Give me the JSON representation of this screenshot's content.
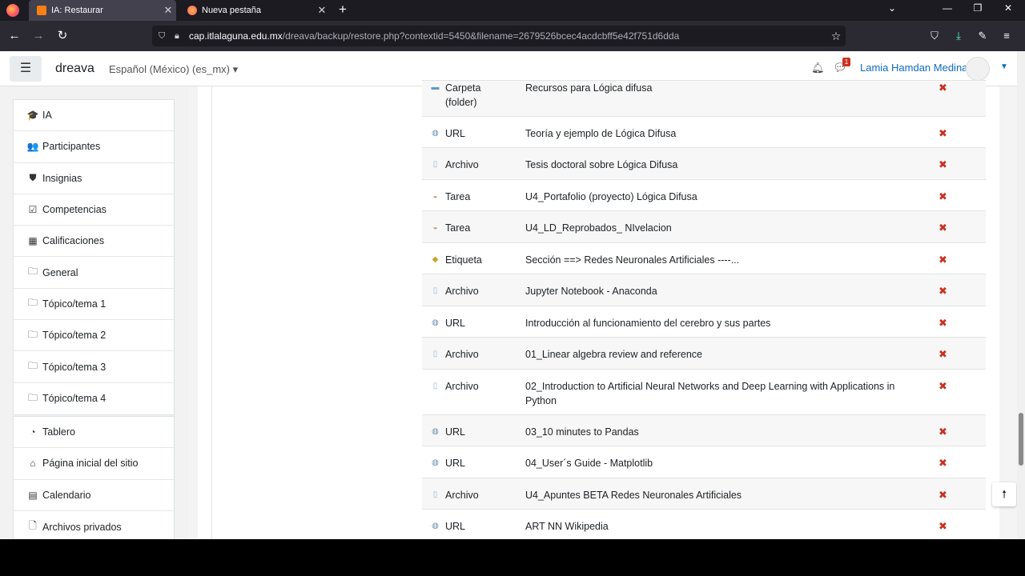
{
  "browser": {
    "tabs": [
      {
        "label": "IA: Restaurar",
        "active": true
      },
      {
        "label": "Nueva pestaña",
        "active": false
      }
    ],
    "url_domain": "cap.itlalaguna.edu.mx",
    "url_path": "/dreava/backup/restore.php?contextid=5450&filename=2679526bcec4acdcbff5e42f751d6dda",
    "new_tab_glyph": "+",
    "close_glyph": "✕"
  },
  "header": {
    "site_name": "dreava",
    "language": "Español (México) (es_mx)",
    "message_count": "1",
    "user_name": "Lamia Hamdan Medina"
  },
  "sidebar": {
    "course_items": [
      {
        "label": "IA",
        "icon": "graduation-cap-icon",
        "glyph": "🎓"
      },
      {
        "label": "Participantes",
        "icon": "users-icon",
        "glyph": "👥"
      },
      {
        "label": "Insignias",
        "icon": "shield-icon",
        "glyph": "⛊"
      },
      {
        "label": "Competencias",
        "icon": "check-square-icon",
        "glyph": "☑"
      },
      {
        "label": "Calificaciones",
        "icon": "table-icon",
        "glyph": "▦"
      },
      {
        "label": "General",
        "icon": "folder-icon",
        "glyph": "🗀"
      },
      {
        "label": "Tópico/tema 1",
        "icon": "folder-icon",
        "glyph": "🗀"
      },
      {
        "label": "Tópico/tema 2",
        "icon": "folder-icon",
        "glyph": "🗀"
      },
      {
        "label": "Tópico/tema 3",
        "icon": "folder-icon",
        "glyph": "🗀"
      },
      {
        "label": "Tópico/tema 4",
        "icon": "folder-icon",
        "glyph": "🗀"
      }
    ],
    "site_items": [
      {
        "label": "Tablero",
        "icon": "dashboard-icon",
        "glyph": "◔"
      },
      {
        "label": "Página inicial del sitio",
        "icon": "home-icon",
        "glyph": "⌂"
      },
      {
        "label": "Calendario",
        "icon": "calendar-icon",
        "glyph": "▤"
      },
      {
        "label": "Archivos privados",
        "icon": "file-icon",
        "glyph": "🗋"
      }
    ]
  },
  "activities": [
    {
      "type": "Carpeta (folder)",
      "name": "Recursos para Lógica difusa",
      "icon": "folder-icon",
      "color": "#5b9bd5"
    },
    {
      "type": "URL",
      "name": "Teoría y ejemplo de Lógica Difusa",
      "icon": "url-icon",
      "color": "#6b8fae"
    },
    {
      "type": "Archivo",
      "name": "Tesis doctoral sobre Lógica Difusa",
      "icon": "file-icon",
      "color": "#9bb7d4"
    },
    {
      "type": "Tarea",
      "name": "U4_Portafolio (proyecto) Lógica Difusa",
      "icon": "assignment-icon",
      "color": "#b89a74"
    },
    {
      "type": "Tarea",
      "name": "U4_LD_Reprobados_ NIvelacion",
      "icon": "assignment-icon",
      "color": "#b89a74"
    },
    {
      "type": "Etiqueta",
      "name": "Sección ==>  Redes Neuronales Artificiales ----...",
      "icon": "label-icon",
      "color": "#c9a227"
    },
    {
      "type": "Archivo",
      "name": "Jupyter Notebook - Anaconda",
      "icon": "file-icon",
      "color": "#9bb7d4"
    },
    {
      "type": "URL",
      "name": "Introducción al funcionamiento del cerebro y sus partes",
      "icon": "url-icon",
      "color": "#6b8fae"
    },
    {
      "type": "Archivo",
      "name": "01_Linear algebra review and reference",
      "icon": "file-icon",
      "color": "#9bb7d4"
    },
    {
      "type": "Archivo",
      "name": "02_Introduction to Artificial Neural Networks and Deep Learning with Applications in Python",
      "icon": "file-icon",
      "color": "#9bb7d4"
    },
    {
      "type": "URL",
      "name": "03_10 minutes to Pandas",
      "icon": "url-icon",
      "color": "#6b8fae"
    },
    {
      "type": "URL",
      "name": "04_User´s Guide - Matplotlib",
      "icon": "url-icon",
      "color": "#6b8fae"
    },
    {
      "type": "Archivo",
      "name": "U4_Apuntes BETA Redes Neuronales Artificiales",
      "icon": "file-icon",
      "color": "#9bb7d4"
    },
    {
      "type": "URL",
      "name": "ART NN Wikipedia",
      "icon": "url-icon",
      "color": "#6b8fae"
    }
  ],
  "remove_glyph": "✖",
  "scroll_top_glyph": "🠕"
}
